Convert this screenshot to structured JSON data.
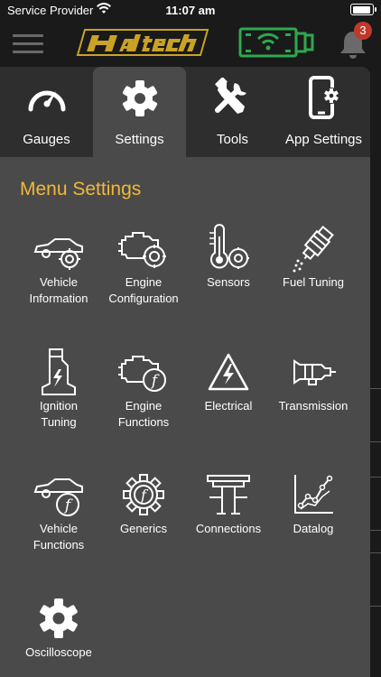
{
  "status_bar": {
    "carrier": "Service Provider",
    "time": "11:07 am"
  },
  "header": {
    "notification_count": "3",
    "brand_color": "#c9a227",
    "device_color": "#2fa84f",
    "icons": [
      "hamburger-icon",
      "haltech-logo",
      "wifi-device-icon",
      "bell-icon"
    ]
  },
  "tabs": [
    {
      "label": "Gauges",
      "icon": "gauge-icon",
      "active": false
    },
    {
      "label": "Settings",
      "icon": "gear-icon",
      "active": true
    },
    {
      "label": "Tools",
      "icon": "tools-icon",
      "active": false
    },
    {
      "label": "App Settings",
      "icon": "phone-gear-icon",
      "active": false
    }
  ],
  "menu": {
    "title": "Menu Settings",
    "title_color": "#f2b73a",
    "items": [
      {
        "label_line1": "Vehicle",
        "label_line2": "Information",
        "icon": "car-gear-icon"
      },
      {
        "label_line1": "Engine",
        "label_line2": "Configuration",
        "icon": "engine-gear-icon"
      },
      {
        "label_line1": "Sensors",
        "label_line2": "",
        "icon": "thermometer-gear-icon"
      },
      {
        "label_line1": "Fuel Tuning",
        "label_line2": "",
        "icon": "fuel-injector-icon"
      },
      {
        "label_line1": "Ignition",
        "label_line2": "Tuning",
        "icon": "ignition-coil-icon"
      },
      {
        "label_line1": "Engine",
        "label_line2": "Functions",
        "icon": "engine-function-icon"
      },
      {
        "label_line1": "Electrical",
        "label_line2": "",
        "icon": "high-voltage-icon"
      },
      {
        "label_line1": "Transmission",
        "label_line2": "",
        "icon": "transmission-icon"
      },
      {
        "label_line1": "Vehicle",
        "label_line2": "Functions",
        "icon": "car-function-icon"
      },
      {
        "label_line1": "Generics",
        "label_line2": "",
        "icon": "gear-function-icon"
      },
      {
        "label_line1": "Connections",
        "label_line2": "",
        "icon": "connections-icon"
      },
      {
        "label_line1": "Datalog",
        "label_line2": "",
        "icon": "datalog-chart-icon"
      },
      {
        "label_line1": "Oscilloscope",
        "label_line2": "",
        "icon": "oscilloscope-gear-icon"
      }
    ]
  }
}
